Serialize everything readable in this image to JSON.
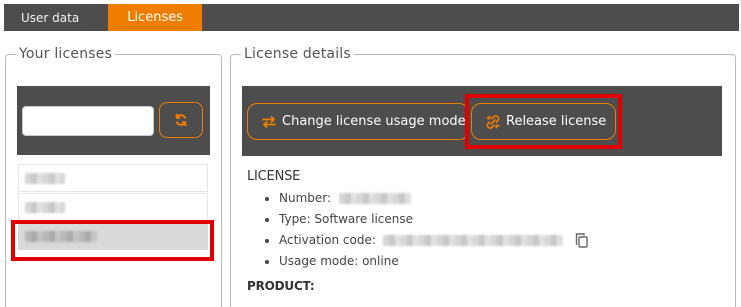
{
  "tabs": [
    {
      "label": "User data",
      "active": false
    },
    {
      "label": "Licenses",
      "active": true
    }
  ],
  "your_licenses": {
    "legend": "Your licenses",
    "search": {
      "value": "",
      "placeholder": ""
    },
    "refresh_icon": "refresh-icon",
    "items": [
      {
        "label": "",
        "redacted": true,
        "selected": false
      },
      {
        "label": "",
        "redacted": true,
        "selected": false
      },
      {
        "label": "",
        "redacted": true,
        "selected": true
      }
    ]
  },
  "license_details": {
    "legend": "License details",
    "actions": {
      "change_mode_label": "Change license usage mode",
      "change_mode_icon": "swap-arrows-icon",
      "release_label": "Release license",
      "release_icon": "unlink-icon"
    },
    "license_heading": "LICENSE",
    "number_label": "Number:",
    "type_text": "Type: Software license",
    "activation_code_label": "Activation code:",
    "usage_mode_text": "Usage mode: online",
    "product_heading": "PRODUCT:"
  },
  "colors": {
    "accent": "#f07d00",
    "dark_panel": "#4d4d4d",
    "highlight": "#e00000",
    "selected_row": "#d9d9d9"
  }
}
